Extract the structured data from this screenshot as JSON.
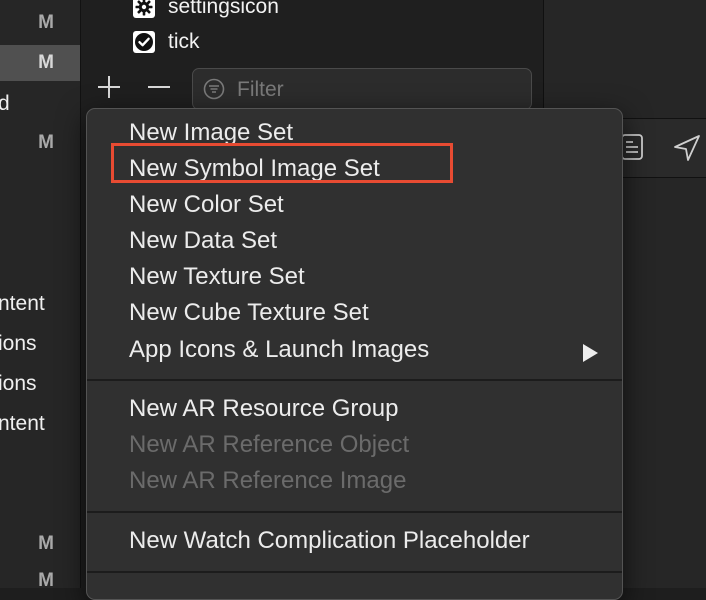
{
  "navigator": {
    "rows": [
      {
        "badge": "M",
        "text": ""
      },
      {
        "badge": "M",
        "text": "",
        "selected": true
      },
      {
        "badge": "",
        "text": "d"
      },
      {
        "badge": "M",
        "text": ""
      },
      {
        "badge": "",
        "text": "ntent"
      },
      {
        "badge": "",
        "text": "ions"
      },
      {
        "badge": "",
        "text": "ions"
      },
      {
        "badge": "",
        "text": "ntent"
      },
      {
        "badge": "M",
        "text": ""
      },
      {
        "badge": "M",
        "text": ""
      }
    ]
  },
  "assets": {
    "items": [
      {
        "label": "settingsicon",
        "icon": "gear-icon"
      },
      {
        "label": "tick",
        "icon": "checkmark-circle-icon"
      }
    ]
  },
  "toolbar": {
    "filter_placeholder": "Filter",
    "add_icon": "plus-icon",
    "remove_icon": "minus-icon"
  },
  "menu": {
    "items": [
      {
        "label": "New Image Set",
        "enabled": true
      },
      {
        "label": "New Symbol Image Set",
        "enabled": true,
        "highlighted": true
      },
      {
        "label": "New Color Set",
        "enabled": true
      },
      {
        "label": "New Data Set",
        "enabled": true
      },
      {
        "label": "New Texture Set",
        "enabled": true
      },
      {
        "label": "New Cube Texture Set",
        "enabled": true
      },
      {
        "label": "App Icons & Launch Images",
        "enabled": true,
        "submenu": true
      },
      {
        "label": "New AR Resource Group",
        "enabled": true
      },
      {
        "label": "New AR Reference Object",
        "enabled": false
      },
      {
        "label": "New AR Reference Image",
        "enabled": false
      },
      {
        "label": "New Watch Complication Placeholder",
        "enabled": true
      }
    ],
    "highlight_color": "#e74b32"
  }
}
